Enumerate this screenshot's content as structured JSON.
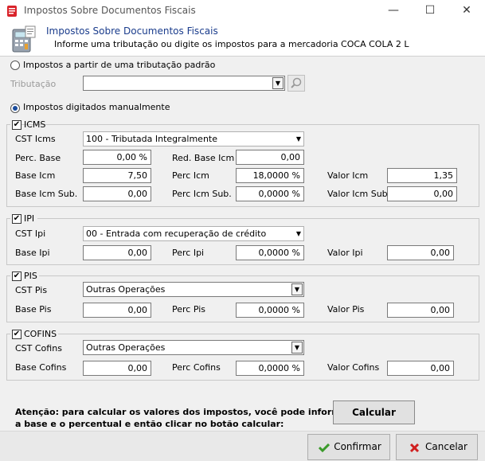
{
  "window": {
    "title": "Impostos Sobre Documentos Fiscais",
    "minimize": "—",
    "maximize": "☐",
    "close": "✕"
  },
  "header": {
    "title": "Impostos Sobre Documentos Fiscais",
    "subtitle": "Informe uma tributação ou digite os impostos para a mercadoria COCA COLA 2 L"
  },
  "padrao": {
    "radio_label": "Impostos a partir de uma tributação padrão",
    "tributacao_label": "Tributação",
    "tributacao_value": ""
  },
  "manual": {
    "radio_label": "Impostos digitados manualmente"
  },
  "icms": {
    "group_label": "ICMS",
    "cst_label": "CST Icms",
    "cst_value": "100 - Tributada Integralmente",
    "perc_base_label": "Perc. Base",
    "perc_base_value": "0,00 %",
    "red_base_label": "Red. Base Icm",
    "red_base_value": "0,00",
    "base_label": "Base Icm",
    "base_value": "7,50",
    "perc_label": "Perc Icm",
    "perc_value": "18,0000 %",
    "valor_label": "Valor Icm",
    "valor_value": "1,35",
    "base_sub_label": "Base Icm Sub.",
    "base_sub_value": "0,00",
    "perc_sub_label": "Perc Icm Sub.",
    "perc_sub_value": "0,0000 %",
    "valor_sub_label": "Valor Icm Sub.",
    "valor_sub_value": "0,00"
  },
  "ipi": {
    "group_label": "IPI",
    "cst_label": "CST Ipi",
    "cst_value": "00 - Entrada com recuperação de crédito",
    "base_label": "Base Ipi",
    "base_value": "0,00",
    "perc_label": "Perc Ipi",
    "perc_value": "0,0000 %",
    "valor_label": "Valor Ipi",
    "valor_value": "0,00"
  },
  "pis": {
    "group_label": "PIS",
    "cst_label": "CST Pis",
    "cst_value": "Outras Operações",
    "base_label": "Base Pis",
    "base_value": "0,00",
    "perc_label": "Perc Pis",
    "perc_value": "0,0000 %",
    "valor_label": "Valor Pis",
    "valor_value": "0,00"
  },
  "cofins": {
    "group_label": "COFINS",
    "cst_label": "CST Cofins",
    "cst_value": "Outras Operações",
    "base_label": "Base Cofins",
    "base_value": "0,00",
    "perc_label": "Perc Cofins",
    "perc_value": "0,0000 %",
    "valor_label": "Valor Cofins",
    "valor_value": "0,00"
  },
  "footer": {
    "notice_line1": "Atenção: para calcular os valores dos impostos, você pode informar",
    "notice_line2": "a base e o percentual e então clicar no botão calcular:",
    "calcular_label": "Calcular",
    "confirmar_label": "Confirmar",
    "cancelar_label": "Cancelar"
  },
  "colors": {
    "accent": "#1a3c8c",
    "app_icon": "#d9232a",
    "confirm_icon": "#3a9a2a",
    "cancel_icon": "#d02020"
  }
}
